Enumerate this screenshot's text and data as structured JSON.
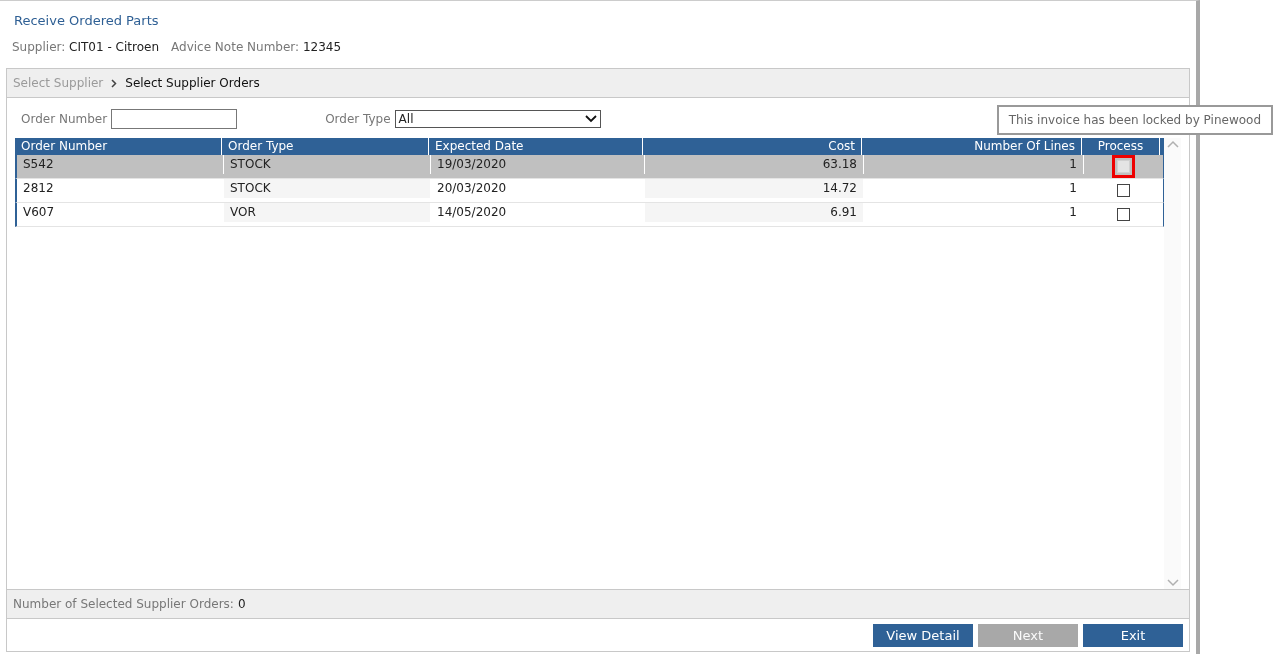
{
  "title": "Receive Ordered Parts",
  "info": [
    {
      "label": "Supplier:",
      "value": "CIT01 - Citroen"
    },
    {
      "label": "Advice Note Number:",
      "value": "12345"
    }
  ],
  "breadcrumb": [
    {
      "label": "Select Supplier",
      "selected": false
    },
    {
      "label": "Select Supplier Orders",
      "selected": true
    }
  ],
  "filters": {
    "order_number": {
      "label": "Order Number"
    },
    "order_type": {
      "label": "Order Type",
      "value": "All"
    }
  },
  "table": {
    "columns": [
      "Order Number",
      "Order Type",
      "Expected Date",
      "Cost",
      "Number Of Lines",
      "Process"
    ],
    "rows": [
      {
        "cells": [
          "S542",
          "STOCK",
          "19/03/2020",
          "63.18",
          "1"
        ],
        "selected": true,
        "process": {
          "checked": false,
          "disabled": true,
          "highlighted": true
        }
      },
      {
        "cells": [
          "2812",
          "STOCK",
          "20/03/2020",
          "14.72",
          "1"
        ],
        "selected": false,
        "process": {
          "checked": false,
          "disabled": false,
          "highlighted": false
        }
      },
      {
        "cells": [
          "V607",
          "VOR",
          "14/05/2020",
          "6.91",
          "1"
        ],
        "selected": false,
        "process": {
          "checked": false,
          "disabled": false,
          "highlighted": false
        }
      }
    ]
  },
  "tooltip": "This invoice has been locked by Pinewood",
  "summary": {
    "label": "Number of Selected Supplier Orders:",
    "value": "0"
  },
  "buttons": [
    {
      "label": "View Detail",
      "disabled": false
    },
    {
      "label": "Next",
      "disabled": true
    },
    {
      "label": "Exit",
      "disabled": false
    }
  ]
}
